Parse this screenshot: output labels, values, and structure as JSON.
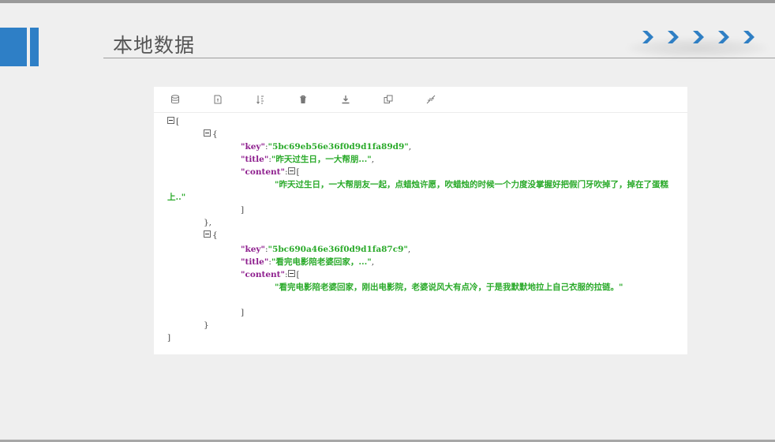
{
  "slide": {
    "title": "本地数据",
    "accent_color": "#2e7fc6",
    "chevron_count": 5,
    "chevron_color": "#2f7fc4"
  },
  "toolbar": {
    "icons": [
      "database-icon",
      "file-icon",
      "sort-icon",
      "trash-icon",
      "download-icon",
      "copy-icon",
      "collapse-icon"
    ]
  },
  "json_view": {
    "root_open": "[",
    "root_close": "]",
    "items": [
      {
        "open": "{",
        "key_label": "\"key\"",
        "key_value": "\"5bc69eb56e36f0d9d1fa89d9\"",
        "title_label": "\"title\"",
        "title_value": "\"昨天过生日，一大帮朋...\"",
        "content_label": "\"content\"",
        "content_open": "[",
        "content_text": "\"昨天过生日，一大帮朋友一起，点蜡烛许愿，吹蜡烛的时候一个力度没掌握好把假门牙吹掉了，掉在了蛋糕上..\"",
        "content_close": "]",
        "close": "},"
      },
      {
        "open": "{",
        "key_label": "\"key\"",
        "key_value": "\"5bc690a46e36f0d9d1fa87c9\"",
        "title_label": "\"title\"",
        "title_value": "\"看完电影陪老婆回家，...\"",
        "content_label": "\"content\"",
        "content_open": "[",
        "content_text": "\"看完电影陪老婆回家，刚出电影院，老婆说风大有点冷，于是我默默地拉上自己衣服的拉链。\"",
        "content_close": "]",
        "close": "}"
      }
    ]
  }
}
